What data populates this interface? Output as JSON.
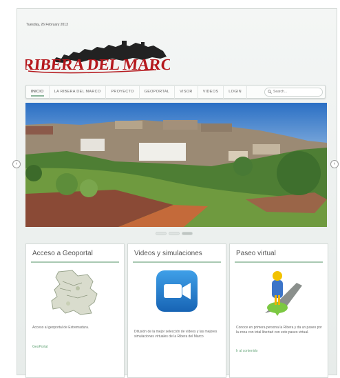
{
  "date": "Tuesday, 26 February 2013",
  "logo": {
    "text": "RIBERA DEL MARCO"
  },
  "nav": {
    "items": [
      "INICIO",
      "LA RIBERA DEL MARCO",
      "PROYECTO",
      "GEOPORTAL",
      "VISOR",
      "VIDEOS",
      "LOGIN"
    ],
    "search_placeholder": "Search..."
  },
  "slider": {
    "slide_count": 3,
    "active_slide": 3
  },
  "cards": [
    {
      "title": "Acceso a Geoportal",
      "description": "Acceso al geoportal de Extremadura.",
      "link": "GeoPortal"
    },
    {
      "title": "Videos y simulaciones",
      "description": "Difusión de la mejor selección de vídeos y las mejores simulaciones virtuales de la Ribera del Marco",
      "link": ""
    },
    {
      "title": "Paseo virtual",
      "description": "Conoce en primera persona la Ribera y da un paseo por la zona con total libertad con este paseo virtual.",
      "link": "Ir al contenido"
    }
  ],
  "colors": {
    "accent": "#8ab59a",
    "link": "#6aa87d",
    "logo_red": "#b5181d"
  },
  "icons": [
    "search-icon",
    "chevron-left-icon",
    "chevron-right-icon",
    "map-icon",
    "video-camera-icon",
    "pegman-icon"
  ]
}
